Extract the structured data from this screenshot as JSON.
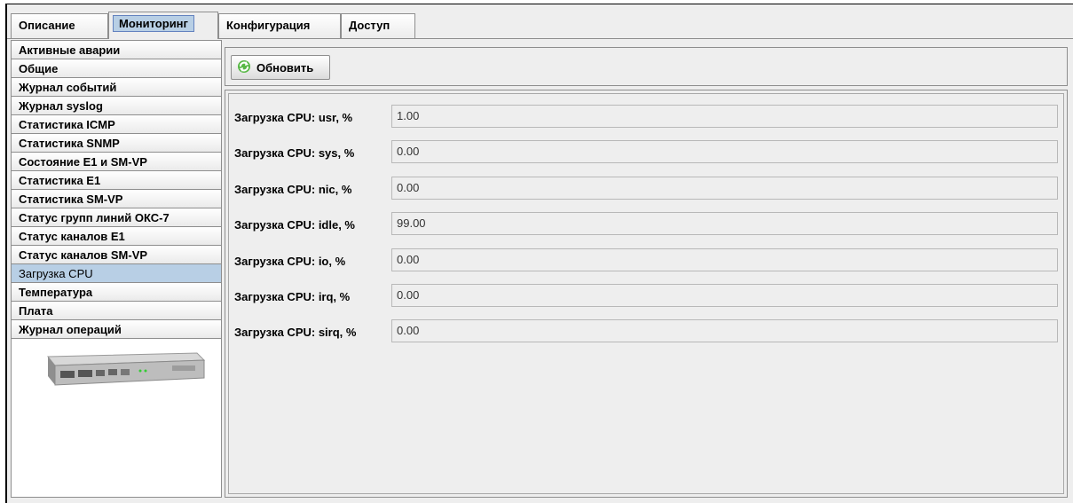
{
  "tabs": [
    {
      "label": "Описание"
    },
    {
      "label": "Мониторинг",
      "active": true
    },
    {
      "label": "Конфигурация"
    },
    {
      "label": "Доступ"
    }
  ],
  "menu": {
    "items": [
      {
        "label": "Активные аварии"
      },
      {
        "label": "Общие"
      },
      {
        "label": "Журнал событий"
      },
      {
        "label": "Журнал syslog"
      },
      {
        "label": "Статистика ICMP"
      },
      {
        "label": "Статистика SNMP"
      },
      {
        "label": "Состояние E1 и SM-VP"
      },
      {
        "label": "Статистика E1"
      },
      {
        "label": "Статистика SM-VP"
      },
      {
        "label": "Статус групп линий ОКС-7"
      },
      {
        "label": "Статус каналов E1"
      },
      {
        "label": "Статус каналов SM-VP"
      },
      {
        "label": "Загрузка CPU",
        "selected": true
      },
      {
        "label": "Температура"
      },
      {
        "label": "Плата"
      },
      {
        "label": "Журнал операций"
      }
    ],
    "device_image": "device-rack-unit-image"
  },
  "toolbar": {
    "refresh_label": "Обновить",
    "refresh_icon": "refresh-icon"
  },
  "fields": [
    {
      "label": "Загрузка CPU: usr, %",
      "value": "1.00"
    },
    {
      "label": "Загрузка CPU: sys, %",
      "value": "0.00"
    },
    {
      "label": "Загрузка CPU: nic, %",
      "value": "0.00"
    },
    {
      "label": "Загрузка CPU: idle, %",
      "value": "99.00"
    },
    {
      "label": "Загрузка CPU: io, %",
      "value": "0.00"
    },
    {
      "label": "Загрузка CPU: irq, %",
      "value": "0.00"
    },
    {
      "label": "Загрузка CPU: sirq, %",
      "value": "0.00"
    }
  ],
  "colors": {
    "selection": "#b8cfe5",
    "background": "#eeeeee",
    "border": "#8e8e8e"
  }
}
